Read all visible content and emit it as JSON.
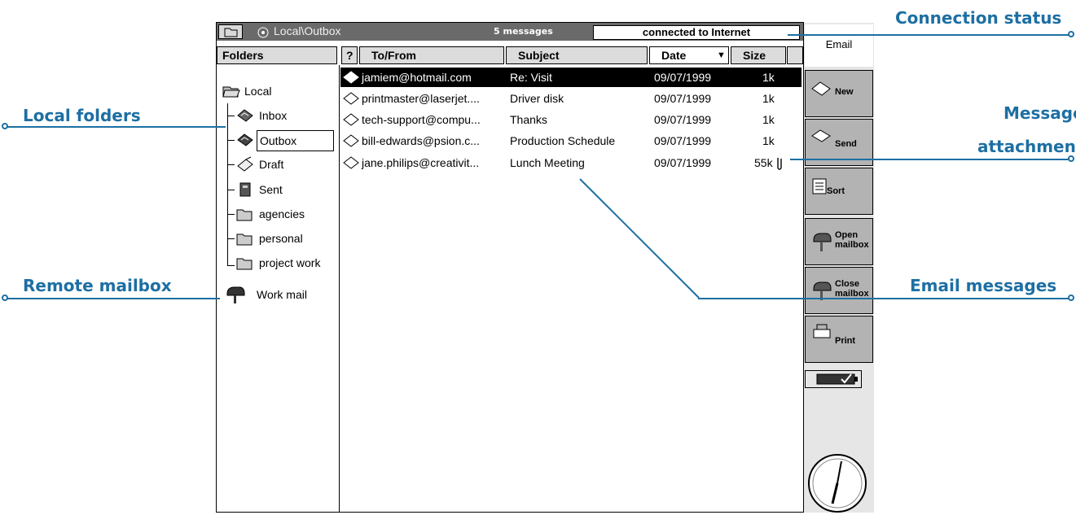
{
  "window": {
    "path": "Local\\Outbox",
    "message_count": "5 messages",
    "connection": "connected to Internet"
  },
  "columns": {
    "folders": "Folders",
    "help": "?",
    "to_from": "To/From",
    "subject": "Subject",
    "date": "Date",
    "size": "Size"
  },
  "folders": [
    {
      "label": "Local",
      "icon": "open-folder-icon"
    },
    {
      "label": "Inbox",
      "icon": "inbox-icon"
    },
    {
      "label": "Outbox",
      "icon": "outbox-icon"
    },
    {
      "label": "Draft",
      "icon": "draft-icon"
    },
    {
      "label": "Sent",
      "icon": "sent-icon"
    },
    {
      "label": "agencies",
      "icon": "folder-icon"
    },
    {
      "label": "personal",
      "icon": "folder-icon"
    },
    {
      "label": "project work",
      "icon": "folder-icon"
    },
    {
      "label": "Work mail",
      "icon": "mailbox-icon"
    }
  ],
  "messages": [
    {
      "to_from": "jamiem@hotmail.com",
      "subject": "Re: Visit",
      "date": "09/07/1999",
      "size": "1k"
    },
    {
      "to_from": "printmaster@laserjet....",
      "subject": "Driver disk",
      "date": "09/07/1999",
      "size": "1k"
    },
    {
      "to_from": "tech-support@compu...",
      "subject": "Thanks",
      "date": "09/07/1999",
      "size": "1k"
    },
    {
      "to_from": "bill-edwards@psion.c...",
      "subject": "Production Schedule",
      "date": "09/07/1999",
      "size": "1k"
    },
    {
      "to_from": "jane.philips@creativit...",
      "subject": "Lunch Meeting",
      "date": "09/07/1999",
      "size": "55k"
    }
  ],
  "toolbar": {
    "title": "Email",
    "new": "New",
    "send": "Send",
    "sort": "Sort",
    "open1": "Open",
    "open2": "mailbox",
    "close1": "Close",
    "close2": "mailbox",
    "print": "Print"
  },
  "callouts": {
    "connection": "Connection status",
    "local": "Local folders",
    "attachment1": "Message",
    "attachment2": "attachment",
    "remote": "Remote mailbox",
    "messages": "Email messages"
  },
  "colors": {
    "callout": "#1d6fa3",
    "titlebar": "#6a6a6a",
    "selection": "#000000"
  }
}
